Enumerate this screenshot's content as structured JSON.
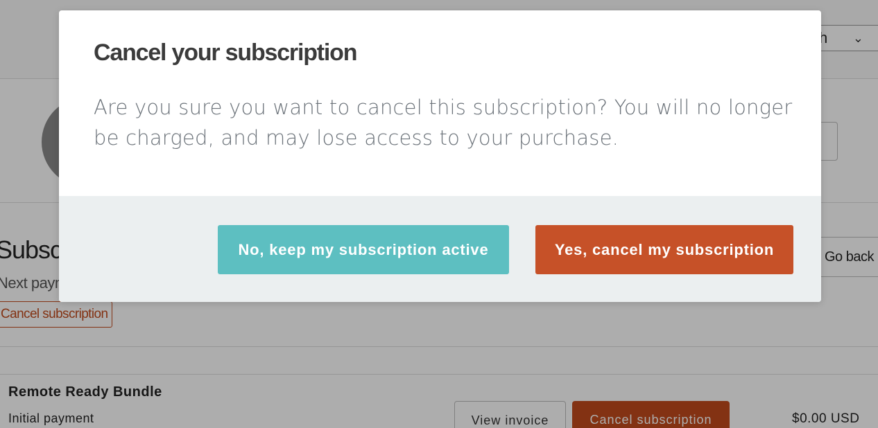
{
  "background": {
    "language_select": {
      "value": "h"
    },
    "subscription": {
      "title": "Subscr",
      "next_payment_label": "Next paym",
      "cancel_button_label": "Cancel subscription",
      "go_back_label": "Go back"
    },
    "item": {
      "product_name": "Remote Ready Bundle",
      "payment_type": "Initial payment",
      "view_invoice_label": "View invoice",
      "cancel_label": "Cancel subscription",
      "price": "$0.00 USD"
    }
  },
  "modal": {
    "title": "Cancel your subscription",
    "body": "Are you sure you want to cancel this subscription? You will no longer be charged, and may lose access to your purchase.",
    "keep_label": "No, keep my subscription active",
    "confirm_label": "Yes, cancel my subscription"
  },
  "colors": {
    "keep_button": "#5dbfc1",
    "confirm_button": "#c65128",
    "footer_bg": "#ebeff0",
    "accent_orange": "#c24b1c"
  }
}
